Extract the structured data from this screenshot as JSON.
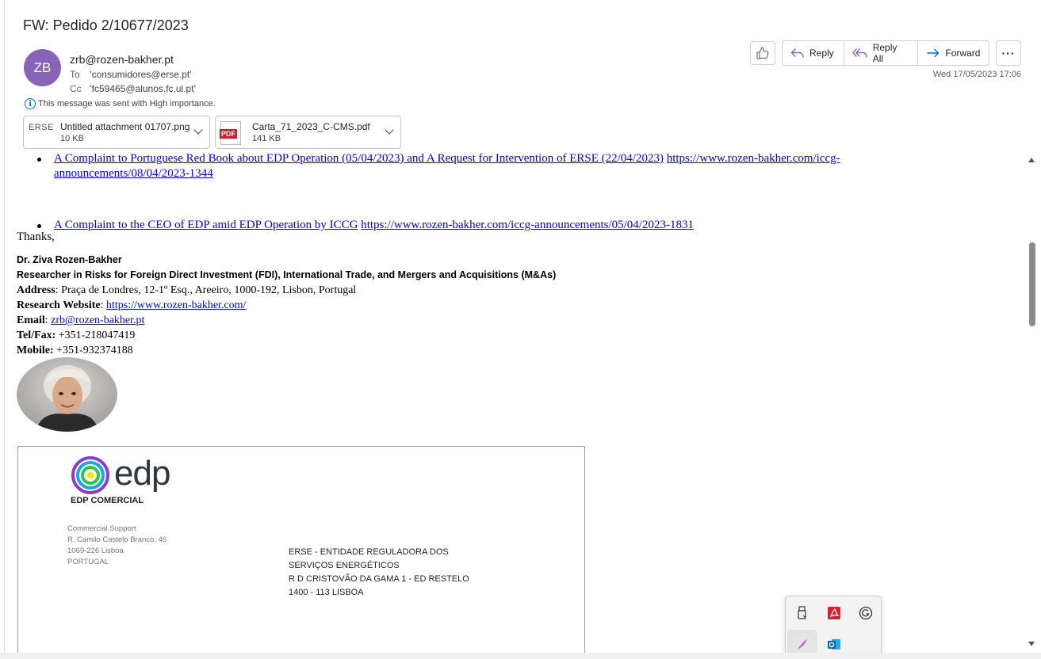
{
  "email": {
    "subject": "FW: Pedido 2/10677/2023",
    "avatar_initials": "ZB",
    "avatar_color": "#8764b8",
    "from": "zrb@rozen-bakher.pt",
    "to_label": "To",
    "to": "'consumidores@erse.pt'",
    "cc_label": "Cc",
    "cc": "'fc59465@alunos.fc.ul.pt'",
    "importance": "This message was sent with High importance.",
    "date": "Wed 17/05/2023 17:06"
  },
  "toolbar": {
    "like_icon": "thumbs-up-icon",
    "reply_label": "Reply",
    "reply_all_label": "Reply All",
    "forward_label": "Forward",
    "more_label": "···"
  },
  "attachments": [
    {
      "name": "Untitled attachment 01707.png",
      "size": "10 KB",
      "thumb_text": "ERSE"
    },
    {
      "name": "Carta_71_2023_C-CMS.pdf",
      "size": "141 KB",
      "badge": "PDF"
    }
  ],
  "body": {
    "bullet1_link": "A Complaint to Portuguese Red Book about EDP Operation (05/04/2023) and A Request for Intervention of ERSE (22/04/2023)",
    "bullet1_url_a": "https://www.rozen-bakher.com/iccg-",
    "bullet1_url_b": "announcements/08/04/2023-1344",
    "bullet2_link": "A Complaint to the CEO of EDP amid EDP Operation by ICCG",
    "bullet2_url": "https://www.rozen-bakher.com/iccg-announcements/05/04/2023-1831",
    "thanks": "Thanks,",
    "sig_name": "Dr. Ziva Rozen-Bakher",
    "sig_title": "Researcher in Risks for Foreign Direct Investment (FDI), International Trade, and Mergers and Acquisitions (M&As)",
    "address_label": "Address",
    "address": ": Praça de Londres, 12-1º Esq., Areeiro, 1000-192, Lisbon, Portugal",
    "website_label": "Research Website",
    "website": "https://www.rozen-bakher.com/",
    "email_label": "Email",
    "email": "zrb@rozen-bakher.pt",
    "tel_label": "Tel/Fax:",
    "tel": " +351-218047419",
    "mobile_label": "Mobile:",
    "mobile": " +351-932374188"
  },
  "letter": {
    "brand": "edp",
    "company": "EDP COMERCIAL",
    "sender_lines": [
      "Commercial Support",
      "R. Camilo Castelo Branco, 46",
      "1069-226 Lisboa",
      "PORTUGAL"
    ],
    "recipient_lines": [
      "ERSE - ENTIDADE REGULADORA DOS",
      "SERVIÇOS ENERGÉTICOS",
      "R D CRISTOVÃO DA GAMA 1 - ED RESTELO",
      "1400 - 113 LISBOA"
    ]
  },
  "tray": {
    "icons": [
      "usb-drive-icon",
      "acrobat-icon",
      "grammarly-icon",
      "pen-icon",
      "outlook-icon"
    ]
  }
}
